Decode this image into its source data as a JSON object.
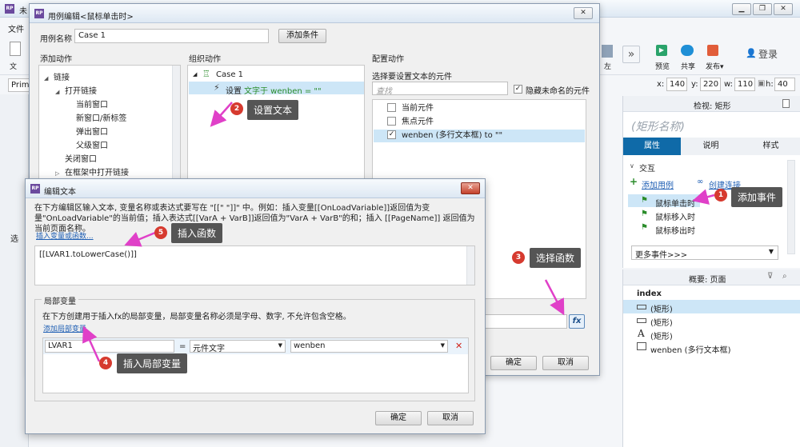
{
  "app": {
    "title_fragment": "未",
    "menu_file": "文件",
    "toolbar_file": "文",
    "primary_dropdown": "Prima",
    "toolbar": {
      "align_left": "左",
      "preview": "预览",
      "share": "共享",
      "publish": "发布▾",
      "login": "登录"
    },
    "geometry_fields": {
      "x_label": "x:",
      "x": "140",
      "y_label": "y:",
      "y": "220",
      "w_label": "w:",
      "w": "110",
      "h_label": "h:",
      "h": "40"
    },
    "inspector": {
      "title": "检视: 矩形",
      "shape_name": "(矩形名称)",
      "tabs": [
        "属性",
        "说明",
        "样式"
      ],
      "interaction_header": "交互",
      "add_case": "添加用例",
      "create_link": "创建连接",
      "events": [
        "鼠标单击时",
        "鼠标移入时",
        "鼠标移出时"
      ],
      "more_events": "更多事件>>>"
    },
    "outline": {
      "title": "概要: 页面",
      "items": [
        "index",
        "(矩形)",
        "(矩形)",
        "(矩形)",
        "wenben (多行文本框)"
      ]
    },
    "left_fragment": "选"
  },
  "case_editor": {
    "title": "用例编辑<鼠标单击时>",
    "case_name_label": "用例名称",
    "case_name_value": "Case 1",
    "add_condition": "添加条件",
    "col_add_action": "添加动作",
    "col_organize": "组织动作",
    "col_configure": "配置动作",
    "actions_tree": [
      {
        "label": "链接",
        "indent": 0,
        "exp": "◢"
      },
      {
        "label": "打开链接",
        "indent": 1,
        "exp": "◢"
      },
      {
        "label": "当前窗口",
        "indent": 2,
        "exp": ""
      },
      {
        "label": "新窗口/新标签",
        "indent": 2,
        "exp": ""
      },
      {
        "label": "弹出窗口",
        "indent": 2,
        "exp": ""
      },
      {
        "label": "父级窗口",
        "indent": 2,
        "exp": ""
      },
      {
        "label": "关闭窗口",
        "indent": 1,
        "exp": ""
      },
      {
        "label": "在框架中打开链接",
        "indent": 1,
        "exp": "▷"
      }
    ],
    "org_case": "Case 1",
    "org_action": {
      "verb": "设置",
      "detail": "文字于 wenben = \"\""
    },
    "configure": {
      "section_label": "选择要设置文本的元件",
      "search_placeholder": "查找",
      "hide_unnamed": "隐藏未命名的元件",
      "options": [
        {
          "label": "当前元件",
          "checked": false
        },
        {
          "label": "焦点元件",
          "checked": false
        },
        {
          "label": "wenben (多行文本框) to \"\"",
          "checked": true
        }
      ]
    },
    "fx_label": "fx",
    "ok": "确定",
    "cancel": "取消"
  },
  "edit_text": {
    "title": "编辑文本",
    "description": "在下方编辑区输入文本, 变量名称或表达式要写在 \"[[\" \"]]\" 中。例如：插入变量[[OnLoadVariable]]返回值为变量\"OnLoadVariable\"的当前值；插入表达式[[VarA + VarB]]返回值为\"VarA + VarB\"的和；插入 [[PageName]] 返回值为当前页面名称。",
    "insert_link": "插入变量或函数...",
    "expression": "[[LVAR1.toLowerCase()]]",
    "local_vars_legend": "局部变量",
    "local_vars_desc": "在下方创建用于插入fx的局部变量，局部变量名称必须是字母、数字, 不允许包含空格。",
    "add_local_var": "添加局部变量",
    "var_row": {
      "name": "LVAR1",
      "eq": "=",
      "type": "元件文字",
      "target": "wenben"
    },
    "ok": "确定",
    "cancel": "取消"
  },
  "annotations": [
    {
      "num": "1",
      "text": "添加事件"
    },
    {
      "num": "2",
      "text": "设置文本"
    },
    {
      "num": "3",
      "text": "选择函数"
    },
    {
      "num": "4",
      "text": "插入局部变量"
    },
    {
      "num": "5",
      "text": "插入函数"
    }
  ],
  "colors": {
    "accent": "#0f6aa8",
    "callout": "#555555",
    "marker": "#d63a2f",
    "arrow": "#e040c8",
    "title_blue": "#dde8f3"
  }
}
